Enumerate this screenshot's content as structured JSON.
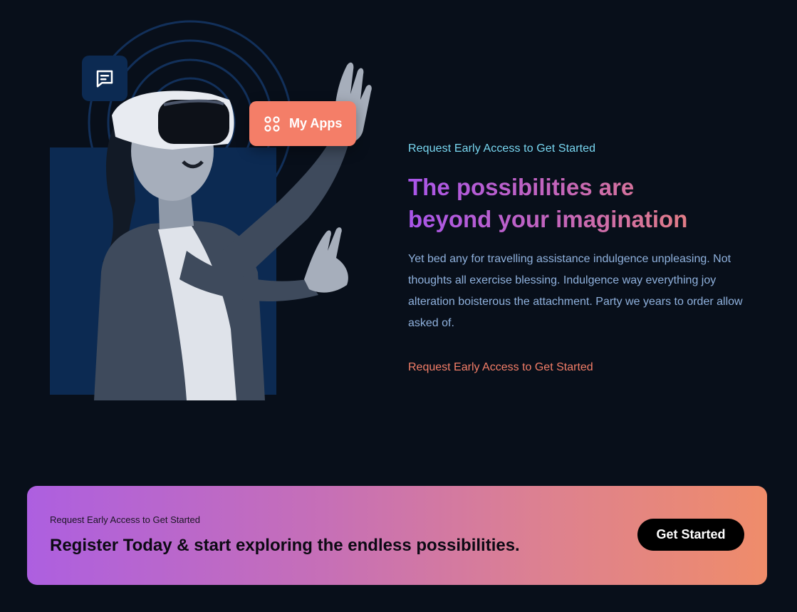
{
  "hero": {
    "floating_chip": {
      "label": "My Apps",
      "icon": "grid-icon"
    },
    "chat_badge": {
      "icon": "chat-icon"
    },
    "photo": {
      "subject": "woman-vr-headset"
    }
  },
  "copy": {
    "eyebrow": "Request Early Access to Get Started",
    "headline_line1": "The possibilities are",
    "headline_line2": "beyond your imagination",
    "body": "Yet bed any for travelling assistance indulgence unpleasing. Not thoughts all exercise blessing. Indulgence way everything joy alteration boisterous the attachment. Party we years to order allow asked of.",
    "cta_link": "Request Early Access to Get Started"
  },
  "banner": {
    "eyebrow": "Request Early Access to Get Started",
    "title": "Register Today & start exploring the endless possibilities.",
    "button_label": "Get Started"
  },
  "colors": {
    "background": "#080f1a",
    "panel": "#0c2a52",
    "accent_cyan": "#79d8f2",
    "accent_coral": "#f47e68",
    "gradient_start": "#a955ea",
    "gradient_end": "#f2896a",
    "body_text": "#8fb1dd"
  }
}
